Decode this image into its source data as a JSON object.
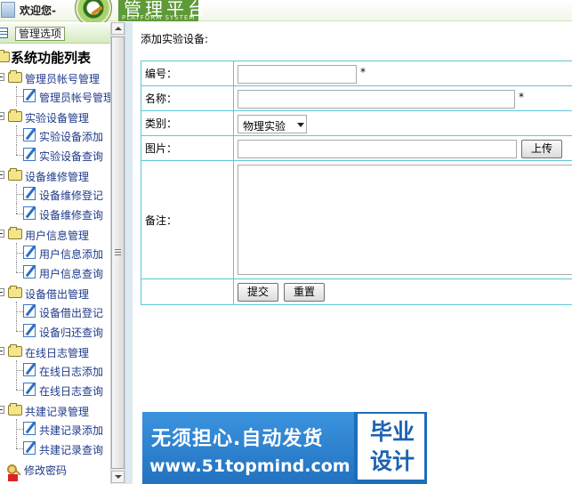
{
  "header": {
    "welcome": "欢迎您-",
    "logo_title": "管理平台",
    "logo_subtitle": "PLATFORM SYSTEM"
  },
  "sidebar": {
    "header_button": "管理选项",
    "tree_title": "系统功能列表",
    "groups": [
      {
        "label": "管理员帐号管理",
        "items": [
          "管理员帐号管理"
        ]
      },
      {
        "label": "实验设备管理",
        "items": [
          "实验设备添加",
          "实验设备查询"
        ]
      },
      {
        "label": "设备维修管理",
        "items": [
          "设备维修登记",
          "设备维修查询"
        ]
      },
      {
        "label": "用户信息管理",
        "items": [
          "用户信息添加",
          "用户信息查询"
        ]
      },
      {
        "label": "设备借出管理",
        "items": [
          "设备借出登记",
          "设备归还查询"
        ]
      },
      {
        "label": "在线日志管理",
        "items": [
          "在线日志添加",
          "在线日志查询"
        ]
      },
      {
        "label": "共建记录管理",
        "items": [
          "共建记录添加",
          "共建记录查询"
        ]
      }
    ],
    "change_password": "修改密码"
  },
  "main": {
    "page_title": "添加实验设备:",
    "form": {
      "number_label": "编号：",
      "number_value": "",
      "name_label": "名称：",
      "name_value": "",
      "required_mark": "*",
      "category_label": "类别：",
      "category_value": "物理实验",
      "image_label": "图片：",
      "image_value": "",
      "upload_button": "上传",
      "note_label": "备注：",
      "note_value": "",
      "submit_button": "提交",
      "reset_button": "重置"
    }
  },
  "ad_banner": {
    "line1": "无须担心.自动发货",
    "line2": "www.51topmind.com",
    "badge": "毕业设计"
  }
}
